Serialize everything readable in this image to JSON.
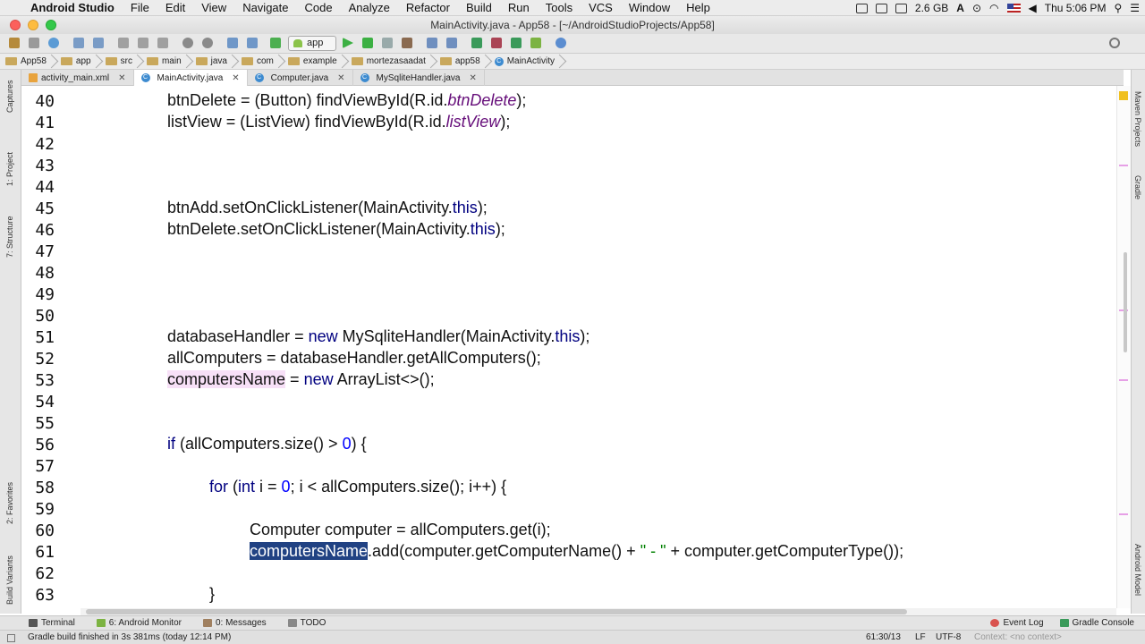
{
  "menubar": {
    "app_name": "Android Studio",
    "items": [
      "File",
      "Edit",
      "View",
      "Navigate",
      "Code",
      "Analyze",
      "Refactor",
      "Build",
      "Run",
      "Tools",
      "VCS",
      "Window",
      "Help"
    ],
    "memory": "2.6 GB",
    "clock": "Thu 5:06 PM"
  },
  "window": {
    "title": "MainActivity.java - App58 - [~/AndroidStudioProjects/App58]"
  },
  "toolbar": {
    "run_config": "app"
  },
  "breadcrumbs": [
    "App58",
    "app",
    "src",
    "main",
    "java",
    "com",
    "example",
    "mortezasaadat",
    "app58",
    "MainActivity"
  ],
  "tabs": [
    {
      "label": "activity_main.xml",
      "icon": "xml-file-icon"
    },
    {
      "label": "MainActivity.java",
      "icon": "class-icon"
    },
    {
      "label": "Computer.java",
      "icon": "class-icon"
    },
    {
      "label": "MySqliteHandler.java",
      "icon": "class-icon"
    }
  ],
  "side_tools_left": [
    "1: Project",
    "7: Structure",
    "Captures",
    "2: Favorites",
    "Build Variants"
  ],
  "side_tools_right": [
    "Maven Projects",
    "Gradle",
    "Android Model"
  ],
  "editor": {
    "lines": [
      {
        "n": "40"
      },
      {
        "n": "41"
      },
      {
        "n": "42"
      },
      {
        "n": "43"
      },
      {
        "n": "44"
      },
      {
        "n": "45"
      },
      {
        "n": "46"
      },
      {
        "n": "47"
      },
      {
        "n": "48"
      },
      {
        "n": "49"
      },
      {
        "n": "50"
      },
      {
        "n": "51"
      },
      {
        "n": "52"
      },
      {
        "n": "53"
      },
      {
        "n": "54"
      },
      {
        "n": "55"
      },
      {
        "n": "56"
      },
      {
        "n": "57"
      },
      {
        "n": "58"
      },
      {
        "n": "59"
      },
      {
        "n": "60"
      },
      {
        "n": "61"
      },
      {
        "n": "62"
      },
      {
        "n": "63"
      }
    ],
    "code": {
      "l40_a": "btnDelete = (Button) findViewById(R.id.",
      "l40_b": "btnDelete",
      "l40_c": ");",
      "l41_a": "listView = (ListView) findViewById(R.id.",
      "l41_b": "listView",
      "l41_c": ");",
      "l45_a": "btnAdd.setOnClickListener(MainActivity.",
      "l45_b": "this",
      "l45_c": ");",
      "l46_a": "btnDelete.setOnClickListener(MainActivity.",
      "l46_b": "this",
      "l46_c": ");",
      "l51_a": "databaseHandler = ",
      "l51_b": "new",
      "l51_c": " MySqliteHandler(MainActivity.",
      "l51_d": "this",
      "l51_e": ");",
      "l52": "allComputers = databaseHandler.getAllComputers();",
      "l53_a": "computersName",
      "l53_b": " = ",
      "l53_c": "new",
      "l53_d": " ArrayList<>();",
      "l56_a": "if",
      "l56_b": " (allComputers.size() > ",
      "l56_c": "0",
      "l56_d": ") {",
      "l58_a": "for",
      "l58_b": " (",
      "l58_c": "int",
      "l58_d": " i = ",
      "l58_e": "0",
      "l58_f": "; i < allComputers.size(); i++) {",
      "l60": "Computer computer = allComputers.get(i);",
      "l61_a": "computersName",
      "l61_b": ".add(computer.getComputerName() + ",
      "l61_c": "\" - \"",
      "l61_d": " + computer.getComputerType());",
      "l63": "}"
    }
  },
  "toolwindows": [
    "Terminal",
    "6: Android Monitor",
    "0: Messages",
    "TODO"
  ],
  "toolwindows_right": [
    "Event Log",
    "Gradle Console"
  ],
  "status": {
    "message": "Gradle build finished in 3s 381ms (today 12:14 PM)",
    "position": "61:30/13",
    "line_sep": "LF",
    "encoding": "UTF-8",
    "context": "Context: <no context>"
  },
  "colors": {
    "keyword": "#000080",
    "field": "#660e7a",
    "selection": "#214283",
    "highlight": "#f7e0f7",
    "string": "#008000"
  }
}
